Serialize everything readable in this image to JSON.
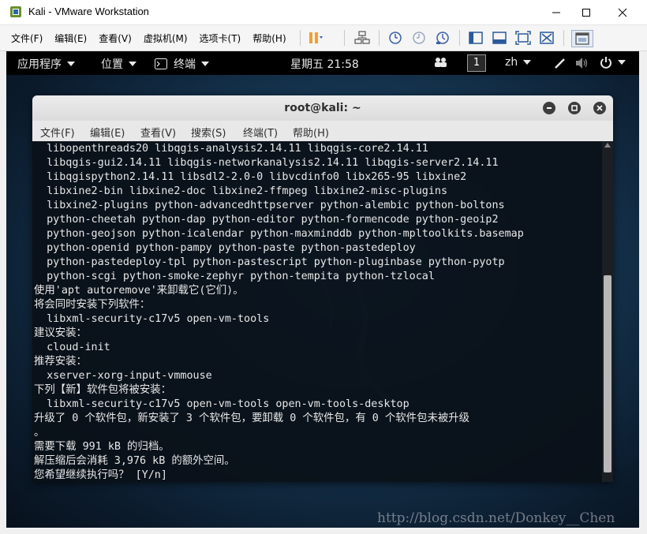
{
  "window": {
    "title": "Kali - VMware Workstation"
  },
  "vmware_menu": [
    "文件(F)",
    "编辑(E)",
    "查看(V)",
    "虚拟机(M)",
    "选项卡(T)",
    "帮助(H)"
  ],
  "gnome_bar": {
    "applications": "应用程序",
    "places": "位置",
    "terminal": "终端",
    "clock": "星期五 21:58",
    "workspace": "1",
    "input_method": "zh"
  },
  "terminal": {
    "title": "root@kali: ~",
    "menu": [
      "文件(F)",
      "编辑(E)",
      "查看(V)",
      "搜索(S)",
      "终端(T)",
      "帮助(H)"
    ],
    "lines": [
      "  libopenthreads20 libqgis-analysis2.14.11 libqgis-core2.14.11",
      "  libqgis-gui2.14.11 libqgis-networkanalysis2.14.11 libqgis-server2.14.11",
      "  libqgispython2.14.11 libsdl2-2.0-0 libvcdinfo0 libx265-95 libxine2",
      "  libxine2-bin libxine2-doc libxine2-ffmpeg libxine2-misc-plugins",
      "  libxine2-plugins python-advancedhttpserver python-alembic python-boltons",
      "  python-cheetah python-dap python-editor python-formencode python-geoip2",
      "  python-geojson python-icalendar python-maxminddb python-mpltoolkits.basemap",
      "  python-openid python-pampy python-paste python-pastedeploy",
      "  python-pastedeploy-tpl python-pastescript python-pluginbase python-pyotp",
      "  python-scgi python-smoke-zephyr python-tempita python-tzlocal",
      "使用'apt autoremove'来卸载它(它们)。",
      "将会同时安装下列软件：",
      "  libxml-security-c17v5 open-vm-tools",
      "建议安装：",
      "  cloud-init",
      "推荐安装：",
      "  xserver-xorg-input-vmmouse",
      "下列【新】软件包将被安装：",
      "  libxml-security-c17v5 open-vm-tools open-vm-tools-desktop",
      "升级了 0 个软件包，新安装了 3 个软件包，要卸载 0 个软件包，有 0 个软件包未被升级",
      "。",
      "需要下载 991 kB 的归档。",
      "解压缩后会消耗 3,976 kB 的额外空间。",
      "您希望继续执行吗？ [Y/n]"
    ]
  },
  "watermark": "http://blog.csdn.net/Donkey__Chen"
}
